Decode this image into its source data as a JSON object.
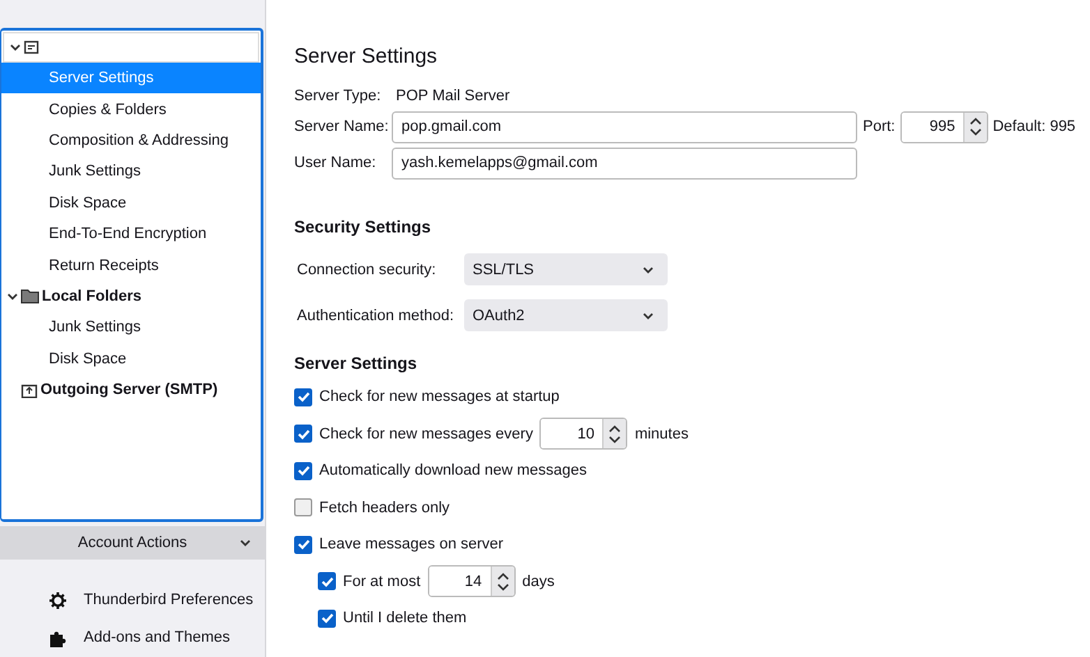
{
  "sidebar": {
    "tree": [
      {
        "kind": "account",
        "expanded": true,
        "selected": false,
        "children": [
          {
            "label": "Server Settings",
            "selected": true
          },
          {
            "label": "Copies & Folders",
            "selected": false
          },
          {
            "label": "Composition & Addressing",
            "selected": false
          },
          {
            "label": "Junk Settings",
            "selected": false
          },
          {
            "label": "Disk Space",
            "selected": false
          },
          {
            "label": "End-To-End Encryption",
            "selected": false
          },
          {
            "label": "Return Receipts",
            "selected": false
          }
        ]
      },
      {
        "kind": "folder",
        "label": "Local Folders",
        "expanded": true,
        "selected": false,
        "children": [
          {
            "label": "Junk Settings",
            "selected": false
          },
          {
            "label": "Disk Space",
            "selected": false
          }
        ]
      },
      {
        "kind": "outgoing",
        "label": "Outgoing Server (SMTP)",
        "selected": false
      }
    ],
    "account_actions": "Account Actions",
    "links": [
      {
        "kind": "gear",
        "label": "Thunderbird Preferences"
      },
      {
        "kind": "puzzle",
        "label": "Add-ons and Themes"
      }
    ]
  },
  "main": {
    "title": "Server Settings",
    "server_type": {
      "label": "Server Type:",
      "value": "POP Mail Server"
    },
    "server_name": {
      "label": "Server Name:",
      "value": "pop.gmail.com"
    },
    "port": {
      "label": "Port:",
      "value": "995",
      "default": "Default: 995"
    },
    "user_name": {
      "label": "User Name:",
      "value": "yash.kemelapps@gmail.com"
    },
    "security": {
      "heading": "Security Settings",
      "rows": [
        {
          "label": "Connection security:",
          "value": "SSL/TLS"
        },
        {
          "label": "Authentication method:",
          "value": "OAuth2"
        }
      ]
    },
    "server": {
      "heading": "Server Settings",
      "options": [
        {
          "label": "Check for new messages at startup",
          "checked": true
        },
        {
          "label": "Check for new messages every",
          "checked": true,
          "spinner": "10",
          "suffix": "minutes"
        },
        {
          "label": "Automatically download new messages",
          "checked": true
        },
        {
          "label": "Fetch headers only",
          "checked": false
        },
        {
          "label": "Leave messages on server",
          "checked": true,
          "children": [
            {
              "label": "For at most",
              "checked": true,
              "spinner": "14",
              "suffix": "days"
            },
            {
              "label": "Until I delete them",
              "checked": true
            }
          ]
        }
      ]
    }
  }
}
